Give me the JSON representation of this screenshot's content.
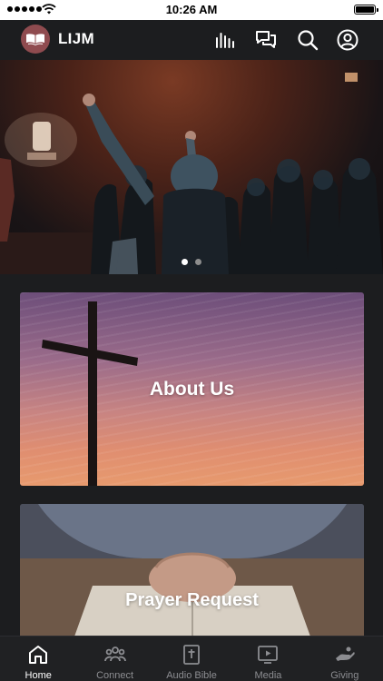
{
  "status_bar": {
    "time": "10:26 AM"
  },
  "header": {
    "title": "LIJM",
    "icons": [
      "audio-bars-icon",
      "chat-icon",
      "search-icon",
      "profile-icon"
    ]
  },
  "carousel": {
    "slide_count": 2,
    "active_slide": 1
  },
  "cards": [
    {
      "title": "About Us"
    },
    {
      "title": "Prayer Request"
    }
  ],
  "tabs": [
    {
      "label": "Home",
      "icon": "home-icon",
      "active": true
    },
    {
      "label": "Connect",
      "icon": "people-icon",
      "active": false
    },
    {
      "label": "Audio Bible",
      "icon": "bible-icon",
      "active": false
    },
    {
      "label": "Media",
      "icon": "play-icon",
      "active": false
    },
    {
      "label": "Giving",
      "icon": "giving-hand-icon",
      "active": false
    }
  ],
  "colors": {
    "background": "#1c1d1f",
    "logo": "#8f4b4f",
    "tab_active": "#ffffff",
    "tab_inactive": "#8c8d91"
  }
}
